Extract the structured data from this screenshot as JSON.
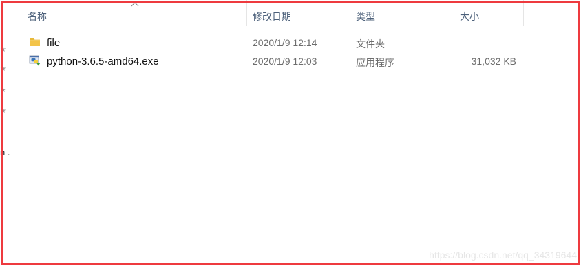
{
  "columns": {
    "name": "名称",
    "date_modified": "修改日期",
    "type": "类型",
    "size": "大小"
  },
  "files": [
    {
      "name": "file",
      "date_modified": "2020/1/9 12:14",
      "type": "文件夹",
      "size": "",
      "icon": "folder-icon"
    },
    {
      "name": "python-3.6.5-amd64.exe",
      "date_modified": "2020/1/9 12:03",
      "type": "应用程序",
      "size": "31,032 KB",
      "icon": "python-installer-icon"
    }
  ],
  "nav_fragment": "n .",
  "pin_glyph": "★",
  "watermark": "https://blog.csdn.net/qq_34319644",
  "colors": {
    "highlight": "#ee3a3f",
    "header_text": "#4c607a",
    "folder": "#f3c44a"
  }
}
